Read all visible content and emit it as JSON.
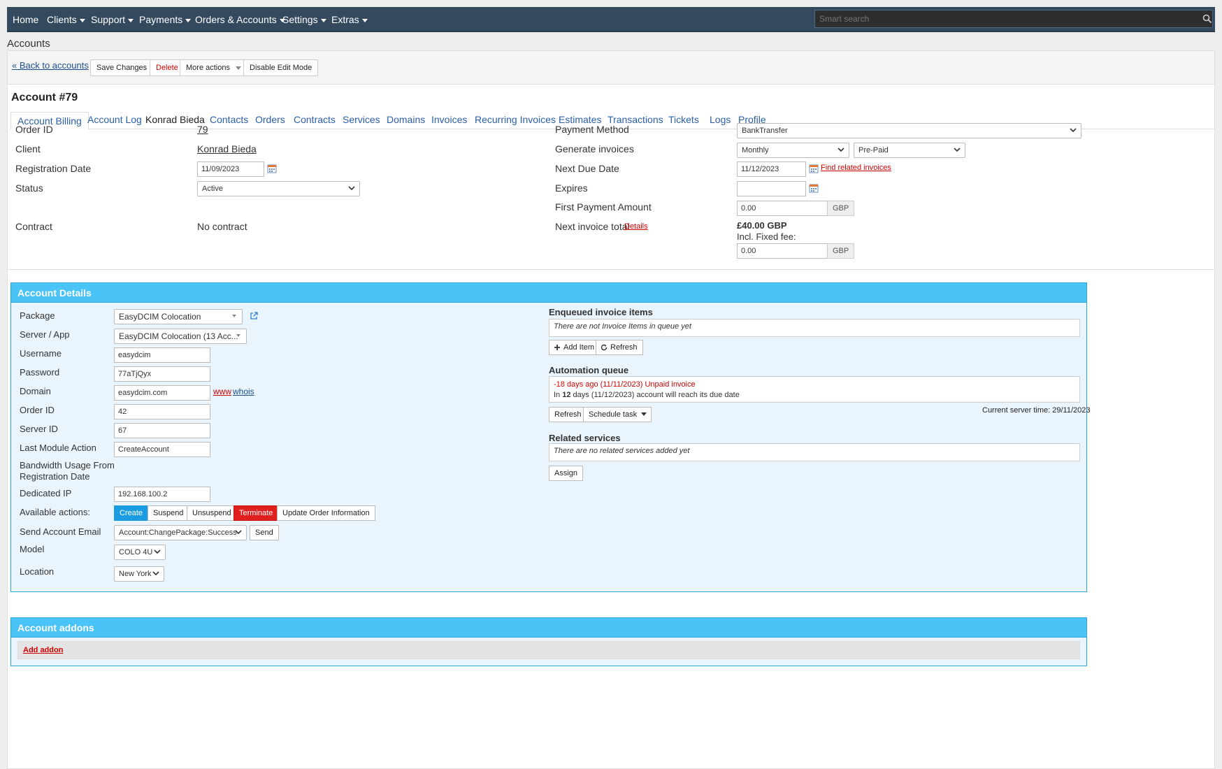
{
  "nav": {
    "items": [
      {
        "label": "Home",
        "dropdown": false
      },
      {
        "label": "Clients",
        "dropdown": true
      },
      {
        "label": "Support",
        "dropdown": true
      },
      {
        "label": "Payments",
        "dropdown": true
      },
      {
        "label": "Orders & Accounts",
        "dropdown": true
      },
      {
        "label": "Settings",
        "dropdown": true
      },
      {
        "label": "Extras",
        "dropdown": true
      }
    ],
    "search_placeholder": "Smart search"
  },
  "page_heading": "Accounts",
  "toolbar": {
    "back_label": "« Back to accounts",
    "save_label": "Save Changes",
    "delete_label": "Delete",
    "more_label": "More actions",
    "disable_edit_label": "Disable Edit Mode"
  },
  "account_title": "Account #79",
  "tabs": [
    "Account Billing",
    "Account Log",
    "Konrad Bieda",
    "Contacts",
    "Orders",
    "Contracts",
    "Services",
    "Domains",
    "Invoices",
    "Recurring Invoices",
    "Estimates",
    "Transactions",
    "Tickets",
    "Logs",
    "Profile"
  ],
  "billing": {
    "left": {
      "order_id_label": "Order ID",
      "order_id": "79",
      "client_label": "Client",
      "client": "Konrad Bieda",
      "reg_date_label": "Registration Date",
      "reg_date": "11/09/2023",
      "status_label": "Status",
      "status": "Active",
      "contract_label": "Contract",
      "contract": "No contract"
    },
    "right": {
      "payment_method_label": "Payment Method",
      "payment_method": "BankTransfer",
      "generate_label": "Generate invoices",
      "cycle": "Monthly",
      "pay_type": "Pre-Paid",
      "next_due_label": "Next Due Date",
      "next_due": "11/12/2023",
      "find_invoices": "Find related invoices",
      "expires_label": "Expires",
      "expires": "",
      "first_payment_label": "First Payment Amount",
      "first_payment": "0.00",
      "currency": "GBP",
      "next_total_label": "Next invoice total",
      "details_link": "Details",
      "next_total": "£40.00 GBP",
      "fixed_fee_label": "Incl. Fixed fee:",
      "fixed_fee": "0.00"
    }
  },
  "details": {
    "title": "Account Details",
    "package_label": "Package",
    "package": "EasyDCIM Colocation",
    "server_label": "Server / App",
    "server": "EasyDCIM Colocation (13 Acc...",
    "username_label": "Username",
    "username": "easydcim",
    "password_label": "Password",
    "password": "77aTjQyx",
    "domain_label": "Domain",
    "domain": "easydcim.com",
    "www": "www",
    "whois": "whois",
    "order_id_label": "Order ID",
    "order_id": "42",
    "server_id_label": "Server ID",
    "server_id": "67",
    "last_action_label": "Last Module Action",
    "last_action": "CreateAccount",
    "bandwidth_label_1": "Bandwidth Usage From",
    "bandwidth_label_2": "Registration Date",
    "dedicated_ip_label": "Dedicated IP",
    "dedicated_ip": "192.168.100.2",
    "actions_label": "Available actions:",
    "actions": {
      "create": "Create",
      "suspend": "Suspend",
      "unsuspend": "Unsuspend",
      "terminate": "Terminate",
      "update": "Update Order Information"
    },
    "send_email_label": "Send Account Email",
    "send_email": "Account:ChangePackage:Success",
    "send_btn": "Send",
    "model_label": "Model",
    "model": "COLO 4U",
    "location_label": "Location",
    "location": "New York",
    "enqueued_title": "Enqueued invoice items",
    "enqueued_empty": "There are not Invoice Items in queue yet",
    "add_item": "Add Item",
    "refresh": "Refresh",
    "automation_title": "Automation queue",
    "auto_line1": "-18 days ago (11/11/2023) Unpaid invoice",
    "auto_line2_pre": "In ",
    "auto_line2_days": "12",
    "auto_line2_post": " days (11/12/2023) account will reach its due date",
    "refresh2": "Refresh",
    "schedule": "Schedule task",
    "server_time": "Current server time: 29/11/2023",
    "related_title": "Related services",
    "related_empty": "There are no related services added yet",
    "assign": "Assign"
  },
  "addons": {
    "title": "Account addons",
    "add": "Add addon"
  },
  "colors": {
    "nav": "#34495e",
    "box_head": "#4ac3f7",
    "create": "#1b9be0",
    "terminate": "#e0201e",
    "link": "#1a4f8f"
  }
}
